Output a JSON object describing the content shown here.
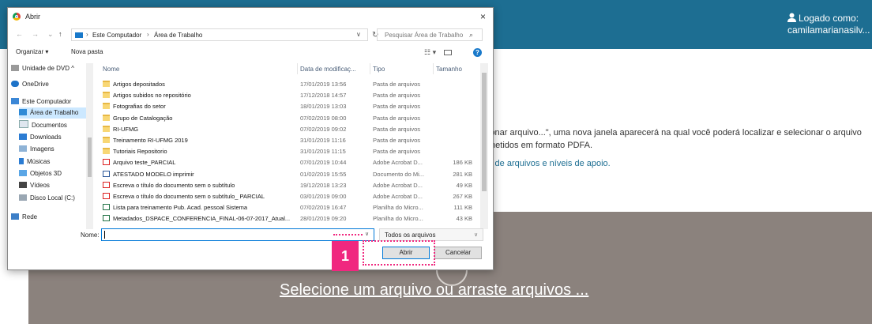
{
  "page": {
    "logged_line1": "Logado como:",
    "logged_line2": "camilamarianasilv...",
    "instruction_line1": "ionar arquivo...\", uma nova janela aparecerá na qual você poderá localizar e selecionar o arquivo",
    "instruction_line2": "metidos em formato PDFA.",
    "link_text": "s de arquivos e níveis de apoio.",
    "dropzone_text": "Selecione um arquivo ou arraste arquivos ..."
  },
  "dialog": {
    "title": "Abrir",
    "close": "×",
    "nav_back": "←",
    "nav_forward": "→",
    "nav_recent": "⌄",
    "nav_up": "↑",
    "breadcrumb": [
      "Este Computador",
      "Área de Trabalho"
    ],
    "search_placeholder": "Pesquisar Área de Trabalho",
    "toolbar": {
      "organize": "Organizar ▾",
      "new_folder": "Nova pasta"
    },
    "nav_pane": [
      {
        "label": "Unidade de DVD ^",
        "icon": "dvd-drive-icon"
      },
      {
        "label": "OneDrive",
        "icon": "cloud-icon"
      },
      {
        "label": "Este Computador",
        "icon": "computer-icon"
      },
      {
        "label": "Área de Trabalho",
        "icon": "desktop-folder-icon",
        "selected": true
      },
      {
        "label": "Documentos",
        "icon": "documents-icon"
      },
      {
        "label": "Downloads",
        "icon": "downloads-icon"
      },
      {
        "label": "Imagens",
        "icon": "pictures-icon"
      },
      {
        "label": "Músicas",
        "icon": "music-icon"
      },
      {
        "label": "Objetos 3D",
        "icon": "objects-3d-icon"
      },
      {
        "label": "Vídeos",
        "icon": "videos-icon"
      },
      {
        "label": "Disco Local (C:)",
        "icon": "local-disk-icon"
      },
      {
        "label": "Rede",
        "icon": "network-icon"
      }
    ],
    "columns": [
      "Nome",
      "Data de modificaç...",
      "Tipo",
      "Tamanho"
    ],
    "files": [
      {
        "name": "Artigos depositados",
        "date": "17/01/2019 13:56",
        "type": "Pasta de arquivos",
        "size": "",
        "kind": "folder"
      },
      {
        "name": "Artigos subidos no repositório",
        "date": "17/12/2018 14:57",
        "type": "Pasta de arquivos",
        "size": "",
        "kind": "folder"
      },
      {
        "name": "Fotografias do setor",
        "date": "18/01/2019 13:03",
        "type": "Pasta de arquivos",
        "size": "",
        "kind": "folder"
      },
      {
        "name": "Grupo de Catalogação",
        "date": "07/02/2019 08:00",
        "type": "Pasta de arquivos",
        "size": "",
        "kind": "folder"
      },
      {
        "name": "RI-UFMG",
        "date": "07/02/2019 09:02",
        "type": "Pasta de arquivos",
        "size": "",
        "kind": "folder"
      },
      {
        "name": "Treinamento RI-UFMG 2019",
        "date": "31/01/2019 11:16",
        "type": "Pasta de arquivos",
        "size": "",
        "kind": "folder"
      },
      {
        "name": "Tutoriais Repositorio",
        "date": "31/01/2019 11:15",
        "type": "Pasta de arquivos",
        "size": "",
        "kind": "folder"
      },
      {
        "name": "Arquivo teste_PARCIAL",
        "date": "07/01/2019 10:44",
        "type": "Adobe Acrobat D...",
        "size": "186 KB",
        "kind": "pdf"
      },
      {
        "name": "ATESTADO MODELO  imprimir",
        "date": "01/02/2019 15:55",
        "type": "Documento do Mi...",
        "size": "281 KB",
        "kind": "doc"
      },
      {
        "name": "Escreva o título do documento sem o subtítulo",
        "date": "19/12/2018 13:23",
        "type": "Adobe Acrobat D...",
        "size": "49 KB",
        "kind": "pdf"
      },
      {
        "name": "Escreva o título do documento sem o subtítulo_ PARCIAL",
        "date": "03/01/2019 09:00",
        "type": "Adobe Acrobat D...",
        "size": "267 KB",
        "kind": "pdf"
      },
      {
        "name": "Lista para treinamento Pub. Acad. pessoal Sistema",
        "date": "07/02/2019 16:47",
        "type": "Planilha do Micro...",
        "size": "111 KB",
        "kind": "xls"
      },
      {
        "name": "Metadados_DSPACE_CONFERENCIA_FINAL-06-07-2017_Atual...",
        "date": "28/01/2019 09:20",
        "type": "Planilha do Micro...",
        "size": "43 KB",
        "kind": "xls"
      }
    ],
    "filename_label": "Nome:",
    "filename_value": "",
    "filter": "Todos os arquivos",
    "open_button": "Abrir",
    "cancel_button": "Cancelar"
  },
  "callout": {
    "number": "1",
    "color": "#f0287f"
  },
  "colors": {
    "topbar": "#1d6e92",
    "dropzone": "#8b827d",
    "selection": "#cce8ff"
  }
}
